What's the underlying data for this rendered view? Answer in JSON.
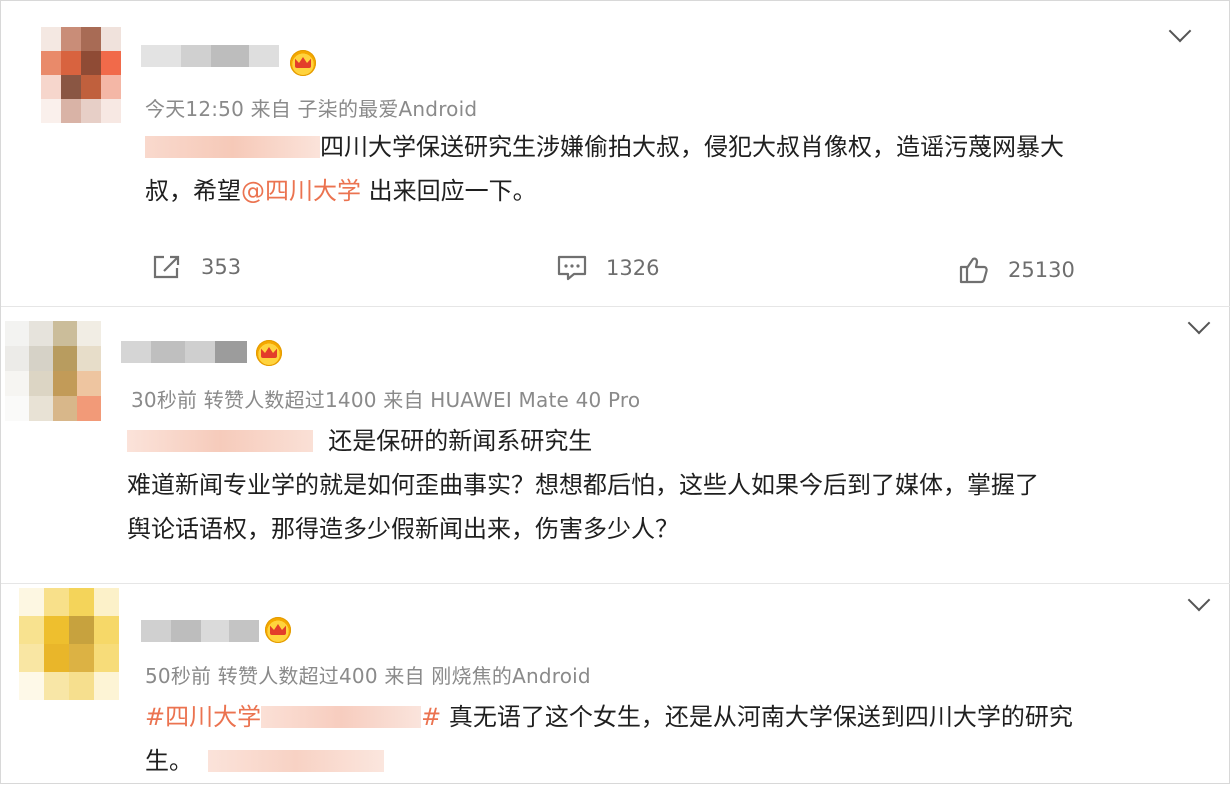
{
  "comments": [
    {
      "meta": "今天12:50  来自 子柒的最爱Android",
      "content_line1_text": "四川大学保送研究生涉嫌偷拍大叔，侵犯大叔肖像权，造谣污蔑网暴大",
      "content_line2_prefix": "叔，希望",
      "content_line2_mention": "@四川大学",
      "content_line2_suffix": " 出来回应一下。",
      "actions": {
        "share_count": "353",
        "comment_count": "1326",
        "like_count": "25130"
      }
    },
    {
      "meta": "30秒前  转赞人数超过1400  来自 HUAWEI Mate 40 Pro",
      "content_line1_text": "还是保研的新闻系研究生",
      "content_line2": "难道新闻专业学的就是如何歪曲事实？想想都后怕，这些人如果今后到了媒体，掌握了",
      "content_line3": "舆论话语权，那得造多少假新闻出来，伤害多少人？"
    },
    {
      "meta": "50秒前  转赞人数超过400  来自 刚烧焦的Android",
      "hashtag_start": "#四川大学",
      "hashtag_end": "#",
      "content_line1_text": " 真无语了这个女生，还是从河南大学保送到四川大学的研究",
      "content_line2": "生。"
    }
  ],
  "icons": {
    "share": "share-icon",
    "comment": "comment-icon",
    "like": "thumbs-up-icon",
    "expand": "chevron-down-icon",
    "vip": "crown-badge-icon"
  },
  "colors": {
    "link": "#eb7350",
    "meta_text": "#8a8a8a",
    "body_text": "#1f1f1f"
  }
}
